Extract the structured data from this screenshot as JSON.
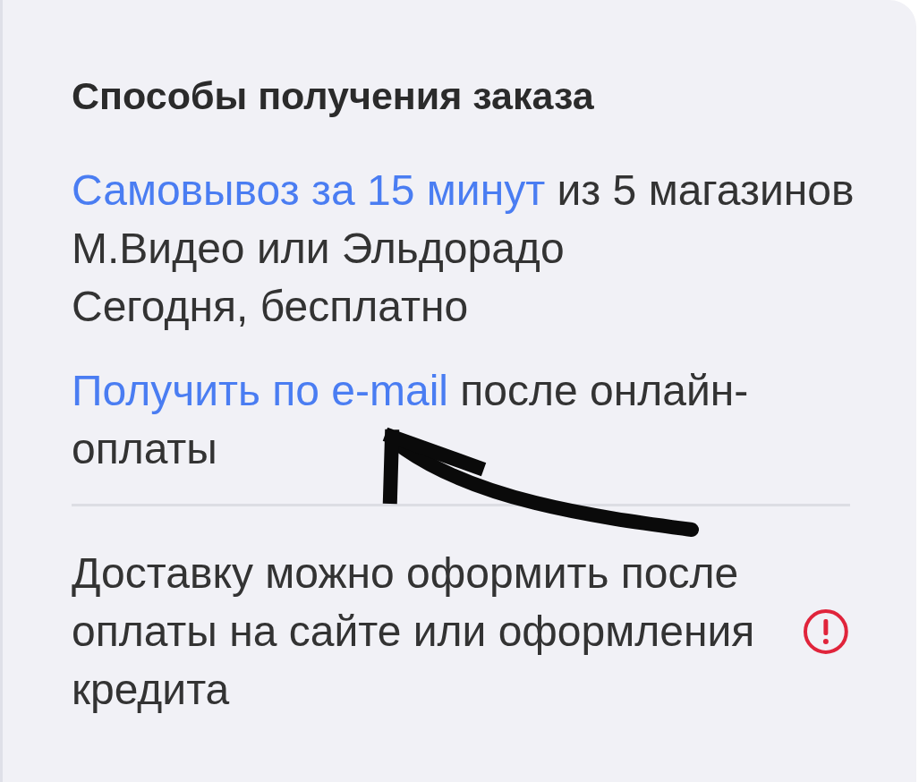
{
  "card": {
    "title": "Способы получения заказа",
    "methods": [
      {
        "link": "Самовывоз за 15 минут",
        "text": " из 5 магазинов М.Видео или Эльдорадо",
        "detail": "Сегодня, бесплатно"
      },
      {
        "link": "Получить по e-mail",
        "text": " после онлайн-оплаты"
      }
    ],
    "note": {
      "text": "Доставку можно оформить после оплаты на сайте или оформления кредита",
      "warning": true
    }
  }
}
